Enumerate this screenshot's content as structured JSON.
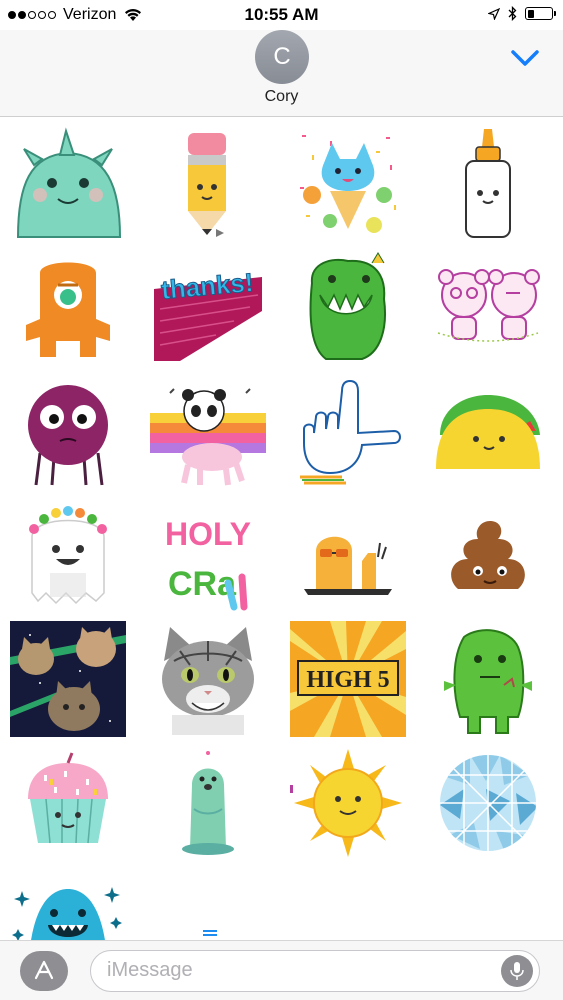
{
  "status_bar": {
    "carrier": "Verizon",
    "time": "10:55 AM",
    "signal_bars_filled": 2,
    "signal_bars_total": 5,
    "battery_level": 0.3
  },
  "header": {
    "avatar_initial": "C",
    "contact_name": "Cory",
    "accent_color": "#147efb"
  },
  "stickers": [
    {
      "name": "horned-monster-sticker"
    },
    {
      "name": "pencil-sticker"
    },
    {
      "name": "cat-ice-cream-sticker"
    },
    {
      "name": "glue-bottle-sticker"
    },
    {
      "name": "orange-cyclops-sticker"
    },
    {
      "name": "thanks-sticker",
      "text": "thanks!"
    },
    {
      "name": "green-monster-sticker"
    },
    {
      "name": "pink-bears-sticker"
    },
    {
      "name": "purple-blob-sticker"
    },
    {
      "name": "panda-unicorn-sticker"
    },
    {
      "name": "loser-hand-sticker"
    },
    {
      "name": "taco-sticker"
    },
    {
      "name": "flower-crown-ghost-sticker"
    },
    {
      "name": "holy-crap-sticker",
      "text_line1": "HOLY",
      "text_line2": "CRa"
    },
    {
      "name": "fries-sunglasses-sticker"
    },
    {
      "name": "poop-sticker"
    },
    {
      "name": "space-cats-sticker"
    },
    {
      "name": "kitten-sticker"
    },
    {
      "name": "high-five-sticker",
      "text": "HIGH 5"
    },
    {
      "name": "green-zombie-sticker"
    },
    {
      "name": "cupcake-sticker"
    },
    {
      "name": "otter-sticker"
    },
    {
      "name": "sun-sticker"
    },
    {
      "name": "disco-ball-sticker"
    },
    {
      "name": "blue-monster-sticker"
    }
  ],
  "input_bar": {
    "placeholder": "iMessage",
    "value": ""
  },
  "icons": {
    "app_store": "app-store-icon",
    "mic": "microphone-icon",
    "chevron": "chevron-down-icon",
    "wifi": "wifi-icon",
    "location": "location-arrow-icon",
    "bluetooth": "bluetooth-icon",
    "battery": "battery-icon"
  }
}
